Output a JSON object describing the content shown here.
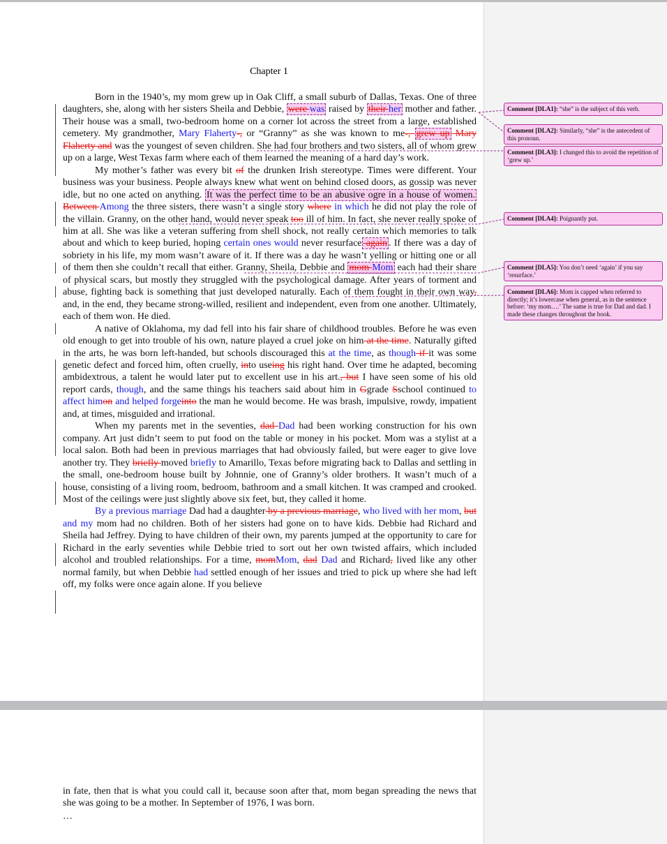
{
  "chapter_title": "Chapter 1",
  "p1": {
    "a": "Born in the 1940’s, my mom grew up in Oak Cliff, a small suburb of Dallas, Texas.  One of three daughters, she, along with her sisters Sheila and Debbie, ",
    "a_del": "were ",
    "a_ins": "was",
    "b": "raised by ",
    "b_del": "their ",
    "b_ins": "her",
    "c": " mother and father.  Their house was a small, two-bedroom home on a corner lot across the street from a large, established cemetery.  My grandmother, ",
    "c_ins": "Mary Flaherty",
    "c_del": "-,",
    "d": " or “Granny” as she was known to me",
    "d_del": "-, ",
    "d_del2": "grew up",
    "d_del3": " Mary Flaherty and",
    "e": " was the youngest of seven children.  She had four brothers and two sisters, all of whom grew up on a large, West Texas farm where each of them learned the meaning of a hard day’s work."
  },
  "p2": {
    "a": "My mother’s father was every bit ",
    "a_del": "of",
    "b": " the drunken Irish stereotype.  Times were different.  Your business was your business.  People always knew what went on behind closed doors, as gossip was never idle, but no one acted on anything.  ",
    "b_hl": "It was the perfect time to be an abusive ogre in a house of women.",
    "c_del": "  Between ",
    "c_ins": "Among",
    "d": " the three sisters, there wasn’t a single story ",
    "d_del": "where",
    "d_ins": " in which",
    "e": " he did not play the role of the villain.  Granny, on the other hand, would never speak ",
    "e_del": "too",
    "f": " ill of him.  In fact, she never really spoke of him at all.  She was like a veteran suffering from shell shock, not really certain which memories to talk about and which to keep buried, hoping ",
    "f_ins": "certain ones would",
    "g": " never resurface",
    "g_del": " again",
    "h": ".  If there was a day of sobriety in his life, my mom wasn’t aware of it.  If there was a day he wasn’t yelling or hitting one or all of them then she couldn’t recall that either.  Granny, Sheila, Debbie and ",
    "h_del": "mom ",
    "h_ins": "Mom",
    "i": " each had their share of physical scars, but mostly they struggled with the psychological damage.  After years of torment and abuse, fighting back is something that just developed naturally.  Each of them fought in their own way",
    "i_del": ",",
    "j": " and, in the end, they became strong-willed, resilient and independent, even from one another.  Ultimately, each of them won.  He died."
  },
  "p3": {
    "a": "A native of Oklahoma, my dad fell into his fair share of childhood troubles.  Before he was even old enough to get into trouble of his own, nature played a cruel joke on him",
    "a_del": " at the time",
    "b": ".  Naturally gifted in the arts, he was born left-handed, but schools discouraged this ",
    "b_ins": "at the time",
    "c": ", as ",
    "c_ins": "though",
    "c_del": " if ",
    "d": "it was some genetic defect and forced him, often cruelly, ",
    "d_del": "in",
    "e": "to use",
    "e_del": "ing",
    "f": " his right hand.  Over time he adapted, becoming ambidextrous, a talent he would later put to excellent use in his art.",
    "f_del": ", but",
    "g": "  I have seen some of his old report cards, ",
    "g_ins": "though",
    "h": ", and the same things his teachers said about him in ",
    "h_del": "G",
    "i": "grade ",
    "i_del": "S",
    "j": "school continued ",
    "j_ins": "to affect him",
    "j_del": "on",
    "j_ins2": " and helped forge",
    "j_del2": "into",
    "k": " the man he would become.  He was brash, impulsive, rowdy, impatient and, at times, misguided and irrational."
  },
  "p4": {
    "a": "When my parents met in the seventies, ",
    "a_del": "dad ",
    "a_ins": "Dad",
    "b": " had been working construction for his own company.  Art just didn’t seem to put food on the table or money in his pocket.  Mom was a stylist at a local salon.  Both had been in previous marriages that had obviously failed, but were eager to give love another try.  They ",
    "b_del": "briefly ",
    "c": "moved ",
    "c_ins": "briefly",
    "d": " to Amarillo, Texas before migrating back to Dallas and settling in the small, one-bedroom house built by Johnnie, one of Granny’s older brothers.  It wasn’t much of a house, consisting of a living room, bedroom, bathroom and a small kitchen.  It was cramped and crooked.  Most of the ceilings were just slightly above six feet, but, they called it home."
  },
  "p5": {
    "a_ins": "By a previous marriage",
    "b": " Dad had a daughter",
    "b_del": " by a previous marriage",
    "c": ", ",
    "c_ins": "who lived with her mom",
    "d": ", ",
    "d_del": "but",
    "d_ins": " and my",
    "e": " mom had no children.  Both of her sisters had gone on to have kids.  Debbie had Richard and Sheila had Jeffrey.  Dying to have children of their own, my parents jumped at the opportunity to care for Richard in the early seventies while Debbie tried to sort out her own twisted affairs, which included alcohol and troubled relationships.  For a time, ",
    "e_del": "mom",
    "e_ins": "Mom",
    "f": ", ",
    "f_del": "dad",
    "f_ins": " Dad",
    "g": " and Richard",
    "g_del": ",",
    "h": " lived like any other normal family, but when Debbie ",
    "h_ins": "had",
    "i": " settled enough of her issues and tried to pick up where she had left off, my folks were once again alone.  If you believe"
  },
  "p6": {
    "text": "in fate, then that is what you could call it, because soon after that, mom began spreading the news that she was going to be a mother.  In September of 1976, I was born."
  },
  "ellipsis": "…",
  "comments": [
    {
      "label": "Comment [DLA1]:",
      "text": " “she” is the subject of this verb."
    },
    {
      "label": "Comment [DLA2]:",
      "text": " Similarly, “she” is the antecedent  of this pronoun."
    },
    {
      "label": "Comment [DLA3]:",
      "text": " I changed this to avoid the repetition of ‘grew up.’"
    },
    {
      "label": "Comment [DLA4]:",
      "text": " Poignantly put."
    },
    {
      "label": "Comment [DLA5]:",
      "text": " You don’t need ‘again’  if you say ‘resurface.’"
    },
    {
      "label": "Comment [DLA6]:",
      "text": " Mom is capped  when referred to directly;  it’s lowercase  when general,  as in the sentence before:  ‘my mom….’  The same is true for Dad and dad.  I made these changes throughout the book."
    }
  ],
  "colors": {
    "insert": "#1a1ae6",
    "delete": "#e01818",
    "comment_bg": "#fbcbf1",
    "comment_border": "#b0309b",
    "margin_pane": "#f3f3f3"
  }
}
